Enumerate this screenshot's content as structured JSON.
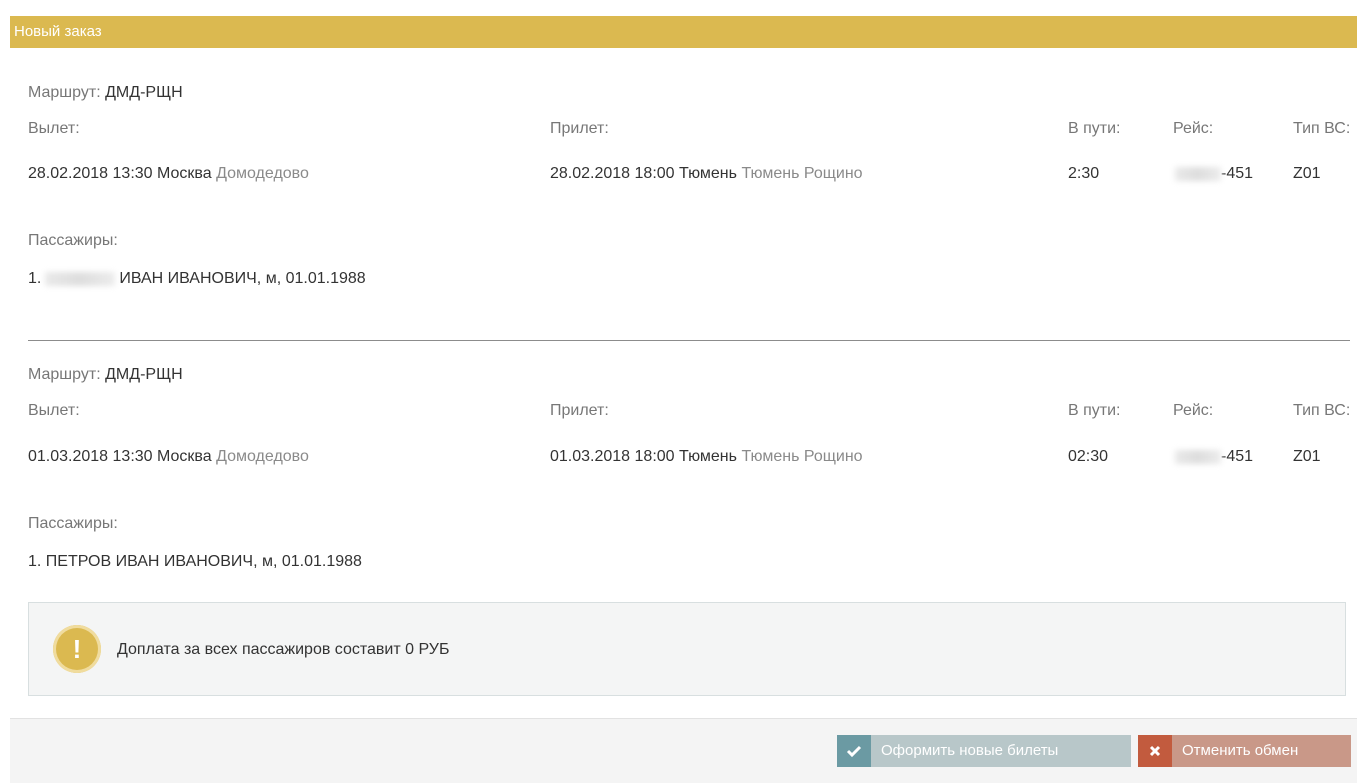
{
  "dialog": {
    "title": "Новый заказ"
  },
  "labels": {
    "route": "Маршрут:",
    "departure": "Вылет:",
    "arrival": "Прилет:",
    "duration": "В пути:",
    "flight": "Рейс:",
    "aircraft": "Тип ВС:",
    "passengers": "Пассажиры:"
  },
  "segments": [
    {
      "route": "ДМД-РЩН",
      "dep_datetime": "28.02.2018 13:30",
      "dep_city": "Москва",
      "dep_airport": "Домодедово",
      "arr_datetime": "28.02.2018 18:00",
      "arr_city": "Тюмень",
      "arr_airport": "Тюмень Рощино",
      "duration": "2:30",
      "flight": "-451",
      "aircraft": "Z01",
      "passenger_index": "1.",
      "passenger_rest": "ИВАН ИВАНОВИЧ, м, 01.01.1988"
    },
    {
      "route": "ДМД-РЩН",
      "dep_datetime": "01.03.2018 13:30",
      "dep_city": "Москва",
      "dep_airport": "Домодедово",
      "arr_datetime": "01.03.2018 18:00",
      "arr_city": "Тюмень",
      "arr_airport": "Тюмень Рощино",
      "duration": "02:30",
      "flight": "-451",
      "aircraft": "Z01",
      "passenger": "1. ПЕТРОВ ИВАН ИВАНОВИЧ, м, 01.01.1988"
    }
  ],
  "alert": {
    "icon": "exclamation-icon",
    "text": "Доплата за всех пассажиров составит 0 РУБ"
  },
  "footer": {
    "submit_label": "Оформить новые билеты",
    "cancel_label": "Отменить обмен"
  },
  "colors": {
    "header": "#dbb950",
    "submit_icon": "#6b9aa3",
    "cancel_icon": "#c25b3e"
  }
}
